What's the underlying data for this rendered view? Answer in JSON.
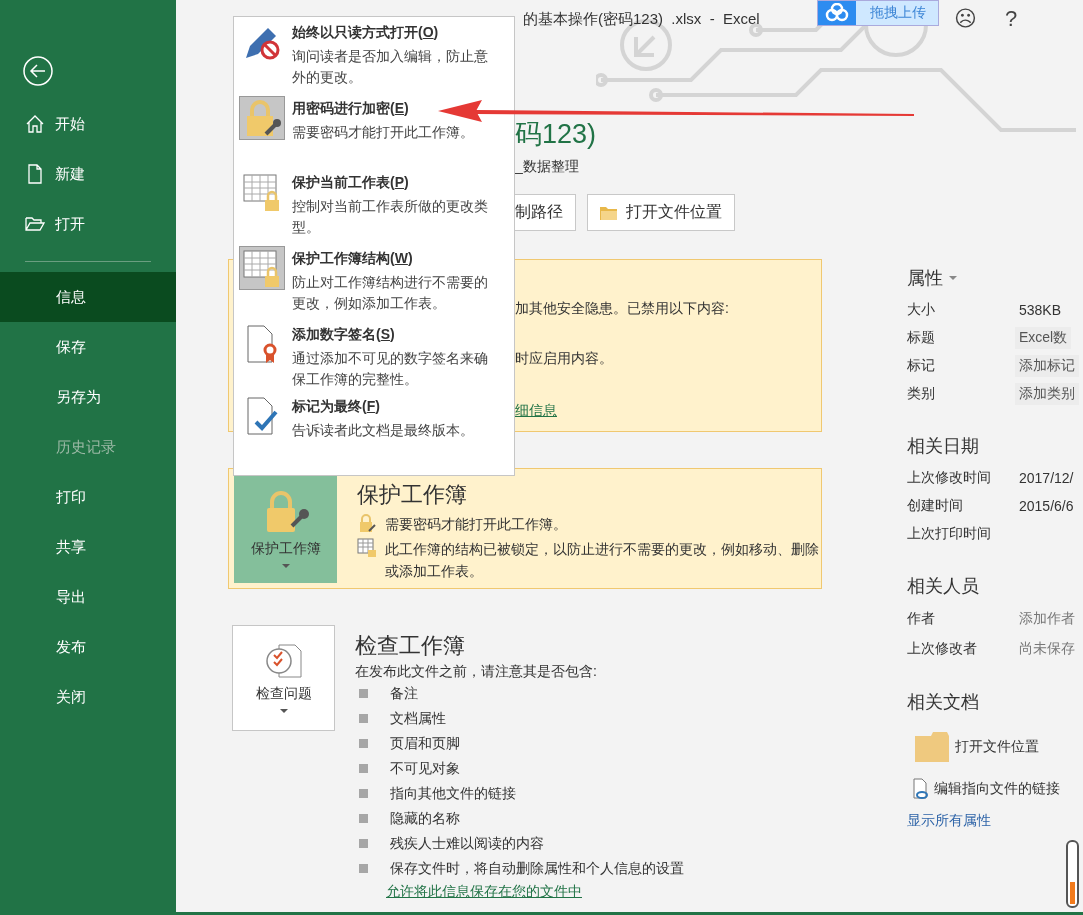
{
  "window": {
    "title": "的基本操作(密码123)  .xlsx  -  Excel",
    "controls": [
      "☹",
      "?"
    ]
  },
  "upload_badge": "拖拽上传",
  "sidebar": {
    "top_items": [
      {
        "label": "开始",
        "kind": "home"
      },
      {
        "label": "新建",
        "kind": "new"
      },
      {
        "label": "打开",
        "kind": "open"
      }
    ],
    "items": [
      {
        "label": "信息",
        "selected": true,
        "disabled": false
      },
      {
        "label": "保存",
        "selected": false,
        "disabled": false
      },
      {
        "label": "另存为",
        "selected": false,
        "disabled": false
      },
      {
        "label": "历史记录",
        "selected": false,
        "disabled": true
      },
      {
        "label": "打印",
        "selected": false,
        "disabled": false
      },
      {
        "label": "共享",
        "selected": false,
        "disabled": false
      },
      {
        "label": "导出",
        "selected": false,
        "disabled": false
      },
      {
        "label": "发布",
        "selected": false,
        "disabled": false
      },
      {
        "label": "关闭",
        "selected": false,
        "disabled": false
      }
    ]
  },
  "info": {
    "file_name": "码123)",
    "path": "_数据整理",
    "buttons": [
      {
        "label": "制路径",
        "kind": "plain"
      },
      {
        "label": "打开文件位置",
        "kind": "folder"
      }
    ],
    "security": {
      "lines": [
        "加其他安全隐患。已禁用以下内容:",
        "时应启用内容。"
      ],
      "link": "细信息"
    },
    "protect": {
      "button": "保护工作簿",
      "title": "保护工作簿",
      "lines": [
        {
          "kind": "lock",
          "text": "需要密码才能打开此工作簿。"
        },
        {
          "kind": "grid",
          "text": "此工作簿的结构已被锁定，以防止进行不需要的更改，例如移动、删除或添加工作表。"
        }
      ]
    },
    "inspect": {
      "button": "检查问题",
      "title": "检查工作簿",
      "intro": "在发布此文件之前，请注意其是否包含:",
      "bullets": [
        "备注",
        "文档属性",
        "页眉和页脚",
        "不可见对象",
        "指向其他文件的链接",
        "隐藏的名称",
        "残疾人士难以阅读的内容",
        "保存文件时，将自动删除属性和个人信息的设置"
      ],
      "link": "允许将此信息保存在您的文件中"
    }
  },
  "menu": {
    "items": [
      {
        "kind": "readonly",
        "title": "始终以只读方式打开(",
        "access_key": "O",
        "title_end": ")",
        "description": "询问读者是否加入编辑，防止意外的更改。",
        "active": false
      },
      {
        "kind": "password",
        "title": "用密码进行加密(",
        "access_key": "E",
        "title_end": ")",
        "description": "需要密码才能打开此工作簿。",
        "active": true
      },
      {
        "kind": "sheet",
        "title": "保护当前工作表(",
        "access_key": "P",
        "title_end": ")",
        "description": "控制对当前工作表所做的更改类型。",
        "active": false
      },
      {
        "kind": "structure",
        "title": "保护工作簿结构(",
        "access_key": "W",
        "title_end": ")",
        "description": "防止对工作簿结构进行不需要的更改，例如添加工作表。",
        "active": true
      },
      {
        "kind": "signature",
        "title": "添加数字签名(",
        "access_key": "S",
        "title_end": ")",
        "description": "通过添加不可见的数字签名来确保工作簿的完整性。",
        "active": false
      },
      {
        "kind": "final",
        "title": "标记为最终(",
        "access_key": "F",
        "title_end": ")",
        "description": "告诉读者此文档是最终版本。",
        "active": false
      }
    ]
  },
  "properties": {
    "heading": "属性",
    "rows": [
      {
        "label": "大小",
        "value": "538KB",
        "kind": "text"
      },
      {
        "label": "标题",
        "value": "Excel数",
        "kind": "editable"
      },
      {
        "label": "标记",
        "value": "添加标记",
        "kind": "editable"
      },
      {
        "label": "类别",
        "value": "添加类别",
        "kind": "editable"
      }
    ]
  },
  "dates": {
    "heading": "相关日期",
    "rows": [
      {
        "label": "上次修改时间",
        "value": "2017/12/"
      },
      {
        "label": "创建时间",
        "value": "2015/6/6"
      },
      {
        "label": "上次打印时间"
      }
    ]
  },
  "people": {
    "heading": "相关人员",
    "rows": [
      {
        "label": "作者",
        "placeholder": "添加作者"
      },
      {
        "label": "上次修改者",
        "placeholder": "尚未保存"
      }
    ]
  },
  "documents": {
    "heading": "相关文档",
    "open_location": "打开文件位置",
    "edit_links": "编辑指向文件的链接",
    "show_all": "显示所有属性"
  }
}
